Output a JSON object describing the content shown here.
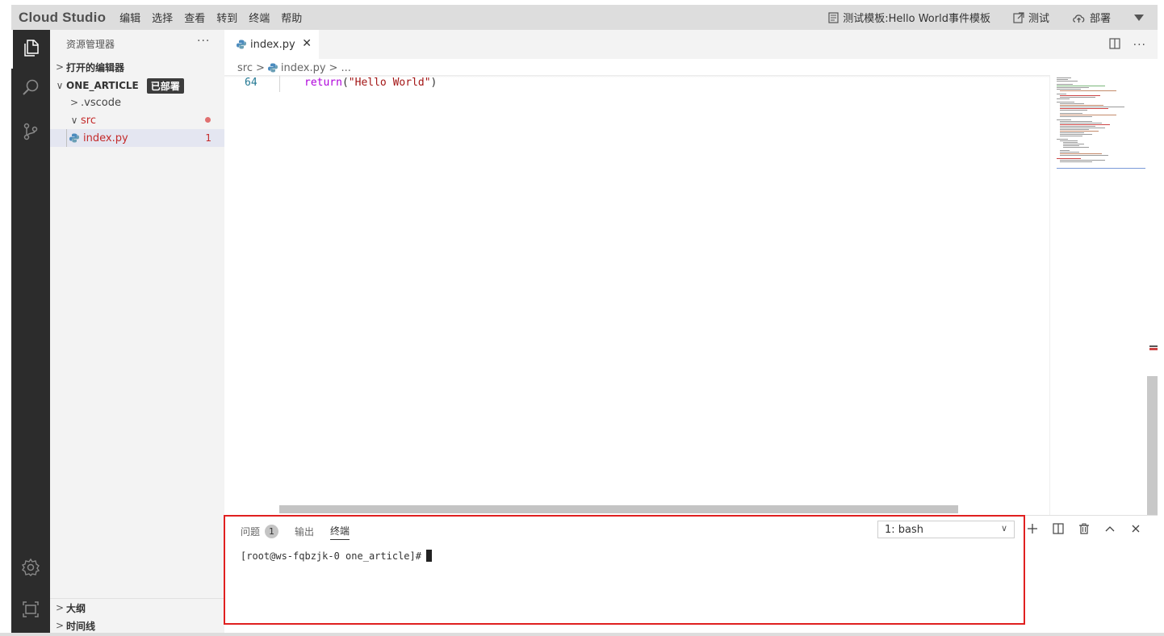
{
  "app": {
    "brand": "Cloud Studio",
    "menu": [
      "编辑",
      "选择",
      "查看",
      "转到",
      "终端",
      "帮助"
    ],
    "template_label": "测试模板:Hello World事件模板",
    "test_label": "测试",
    "deploy_label": "部署"
  },
  "sidebar": {
    "title": "资源管理器",
    "more": "···",
    "open_editors": "打开的编辑器",
    "project_name": "ONE_ARTICLE",
    "project_badge": "已部署",
    "tree": [
      {
        "label": ".vscode",
        "type": "folder-collapsed"
      },
      {
        "label": "src",
        "type": "folder-expanded"
      },
      {
        "label": "index.py",
        "type": "file",
        "errors": "1"
      }
    ],
    "outline": "大纲",
    "timeline": "时间线"
  },
  "editor": {
    "tab_label": "index.py",
    "breadcrumb": [
      "src",
      "index.py",
      "..."
    ],
    "line_number": "64",
    "code_keyword": "return",
    "code_string": "\"Hello World\""
  },
  "panel": {
    "tabs": [
      {
        "label": "问题",
        "badge": "1"
      },
      {
        "label": "输出"
      },
      {
        "label": "终端"
      }
    ],
    "terminal_select": "1: bash",
    "prompt": "[root@ws-fqbzjk-0 one_article]#"
  },
  "colors": {
    "activity_bar": "#2c2c2c",
    "highlight_border": "#e02020",
    "keyword": "#af00db",
    "string": "#a31515",
    "line_number": "#237893"
  }
}
